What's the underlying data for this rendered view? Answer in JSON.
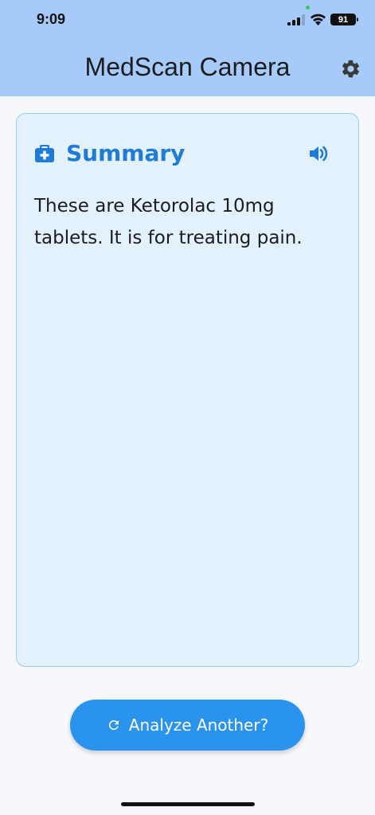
{
  "status_bar": {
    "time": "9:09",
    "battery": "91",
    "icons": [
      "signal-icon",
      "wifi-icon",
      "battery-icon"
    ]
  },
  "header": {
    "title": "MedScan Camera",
    "settings_icon": "gear-icon"
  },
  "summary_card": {
    "title": "Summary",
    "title_icon": "medical-kit-icon",
    "audio_icon": "speaker-icon",
    "text": "These are Ketorolac 10mg tablets. It is for treating pain."
  },
  "actions": {
    "analyze_label": "Analyze Another?",
    "analyze_icon": "refresh-icon"
  },
  "colors": {
    "header_bg": "#a6cbfb",
    "accent": "#1e7bd6",
    "button": "#2a93ee",
    "card_bg": "#e3f1fd",
    "card_border": "#94cdf0"
  }
}
